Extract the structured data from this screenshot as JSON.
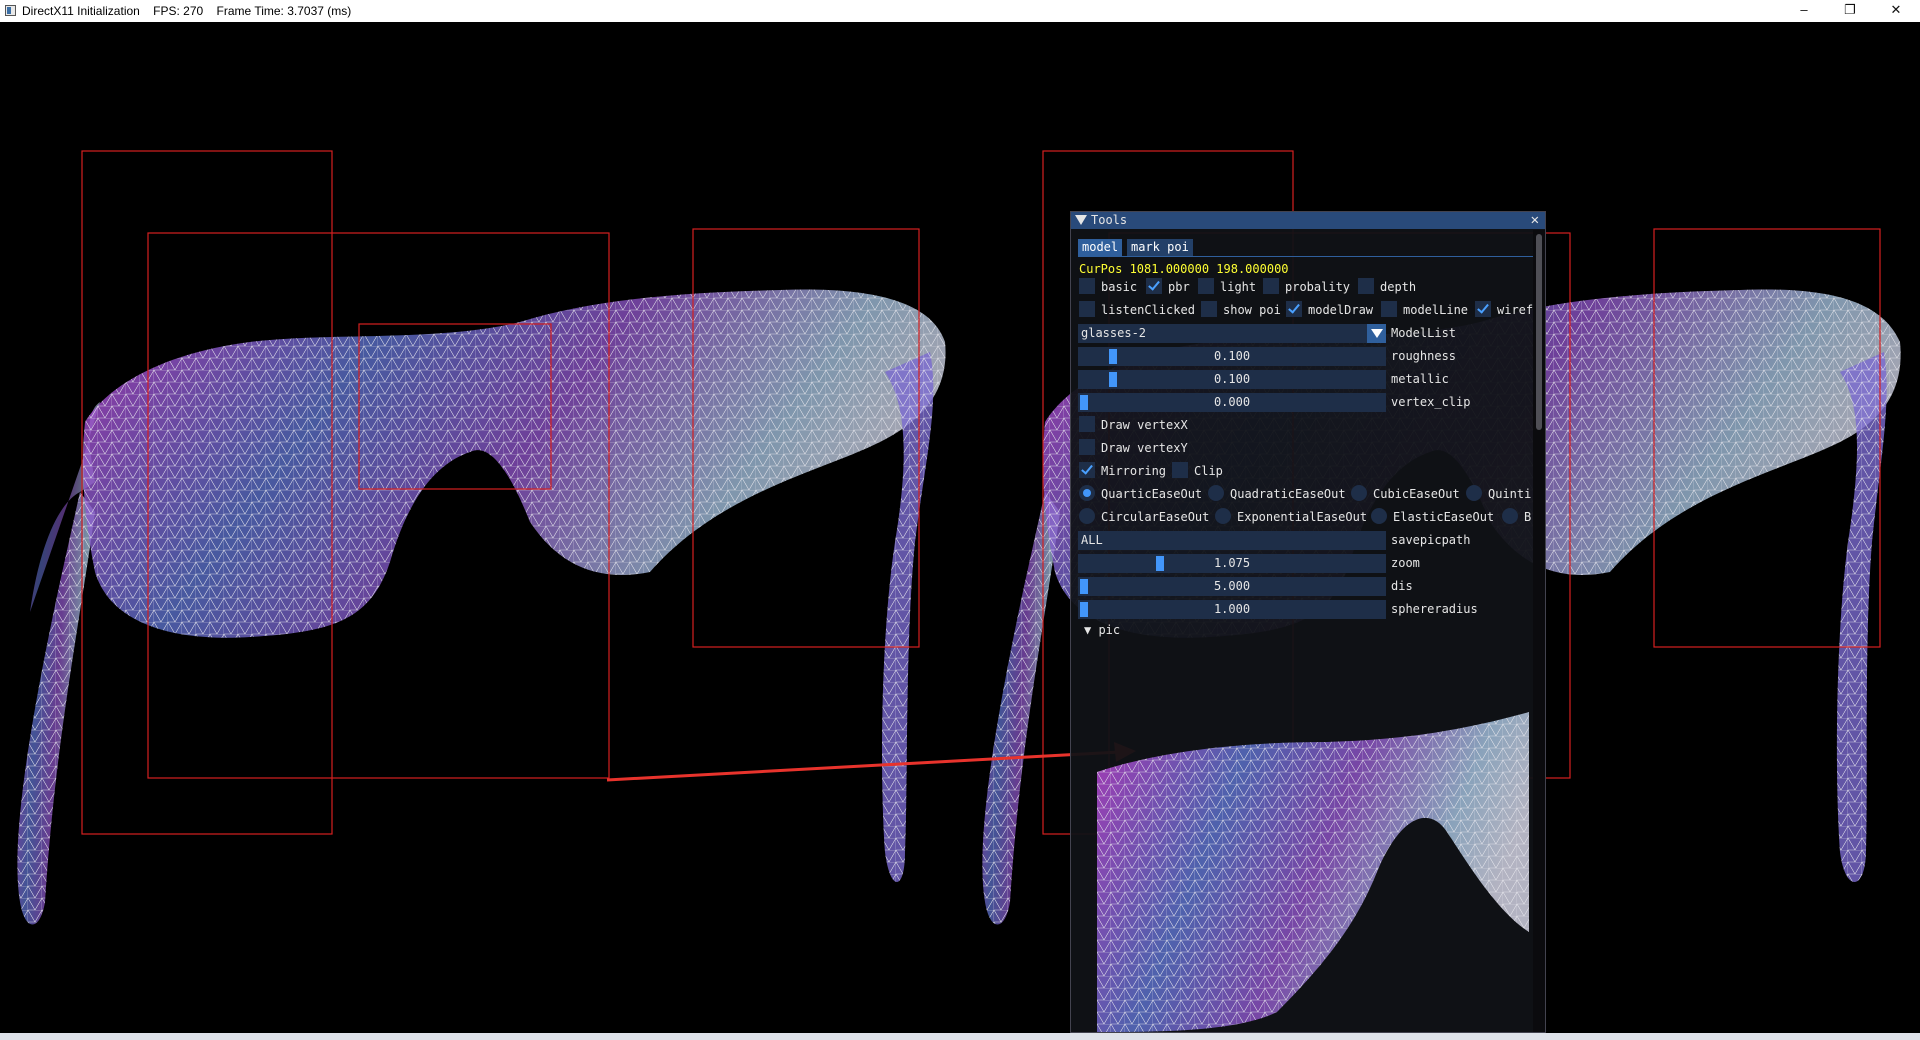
{
  "window": {
    "title": "DirectX11 Initialization    FPS: 270    Frame Time: 3.7037 (ms)",
    "buttons": {
      "minimize": "–",
      "maximize": "❐",
      "close": "✕"
    }
  },
  "tools": {
    "title": "Tools",
    "close": "✕",
    "tabs": [
      "model",
      "mark poi"
    ],
    "curpos": "CurPos 1081.000000 198.000000",
    "row1": [
      {
        "label": "basic",
        "checked": false
      },
      {
        "label": "pbr",
        "checked": true
      },
      {
        "label": "light",
        "checked": false
      },
      {
        "label": "probality",
        "checked": false
      },
      {
        "label": "depth",
        "checked": false
      }
    ],
    "row2": [
      {
        "label": "listenClicked",
        "checked": false
      },
      {
        "label": "show poi",
        "checked": false
      },
      {
        "label": "modelDraw",
        "checked": true
      },
      {
        "label": "modelLine",
        "checked": false
      },
      {
        "label": "wiref",
        "checked": true
      }
    ],
    "modellist": {
      "value": "glasses-2",
      "label": "ModelList"
    },
    "sliders": [
      {
        "value": "0.100",
        "label": "roughness",
        "fraction": 0.1
      },
      {
        "value": "0.100",
        "label": "metallic",
        "fraction": 0.1
      },
      {
        "value": "0.000",
        "label": "vertex_clip",
        "fraction": 0.0
      }
    ],
    "draw_vertexX": {
      "label": "Draw vertexX",
      "checked": false
    },
    "draw_vertexY": {
      "label": "Draw vertexY",
      "checked": false
    },
    "mirroring": {
      "label": "Mirroring",
      "checked": true
    },
    "clip": {
      "label": "Clip",
      "checked": false
    },
    "easing_row1": [
      {
        "label": "QuarticEaseOut",
        "selected": true
      },
      {
        "label": "QuadraticEaseOut",
        "selected": false
      },
      {
        "label": "CubicEaseOut",
        "selected": false
      },
      {
        "label": "Quinti",
        "selected": false
      }
    ],
    "easing_row2": [
      {
        "label": "CircularEaseOut",
        "selected": false
      },
      {
        "label": "ExponentialEaseOut",
        "selected": false
      },
      {
        "label": "ElasticEaseOut",
        "selected": false
      },
      {
        "label": "B",
        "selected": false
      }
    ],
    "savepicpath": {
      "value": "ALL",
      "label": "savepicpath"
    },
    "sliders2": [
      {
        "value": "1.075",
        "label": "zoom",
        "fraction": 0.26
      },
      {
        "value": "5.000",
        "label": "dis",
        "fraction": 0.0
      },
      {
        "value": "1.000",
        "label": "sphereradius",
        "fraction": 0.0
      }
    ],
    "tree_pic": "▼ pic"
  },
  "colors": {
    "accent": "#294a7a",
    "frame": "#1e2e48",
    "grab": "#4296fa",
    "bbox": "#d42020",
    "arrow": "#e8332c"
  }
}
